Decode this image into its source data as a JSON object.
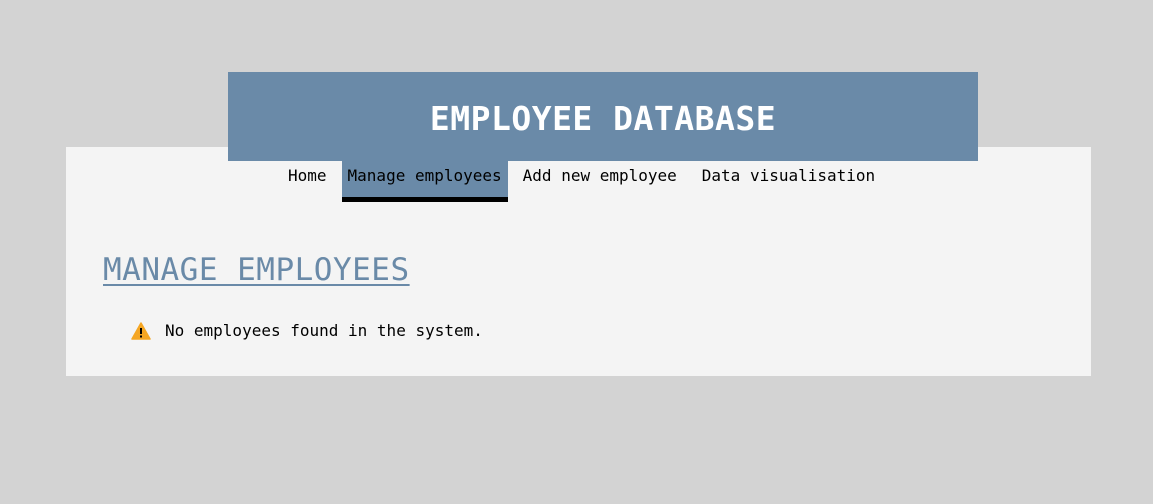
{
  "header": {
    "title": "EMPLOYEE DATABASE"
  },
  "nav": {
    "items": [
      {
        "label": "Home",
        "active": false
      },
      {
        "label": "Manage employees",
        "active": true
      },
      {
        "label": "Add new employee",
        "active": false
      },
      {
        "label": "Data visualisation",
        "active": false
      }
    ]
  },
  "main": {
    "heading": "MANAGE EMPLOYEES",
    "notice": {
      "icon": "warning-icon",
      "text": "No employees found in the system."
    }
  },
  "colors": {
    "background": "#d3d3d3",
    "card": "#f4f4f4",
    "accent": "#6a8aa8",
    "warning": "#f5a623"
  }
}
